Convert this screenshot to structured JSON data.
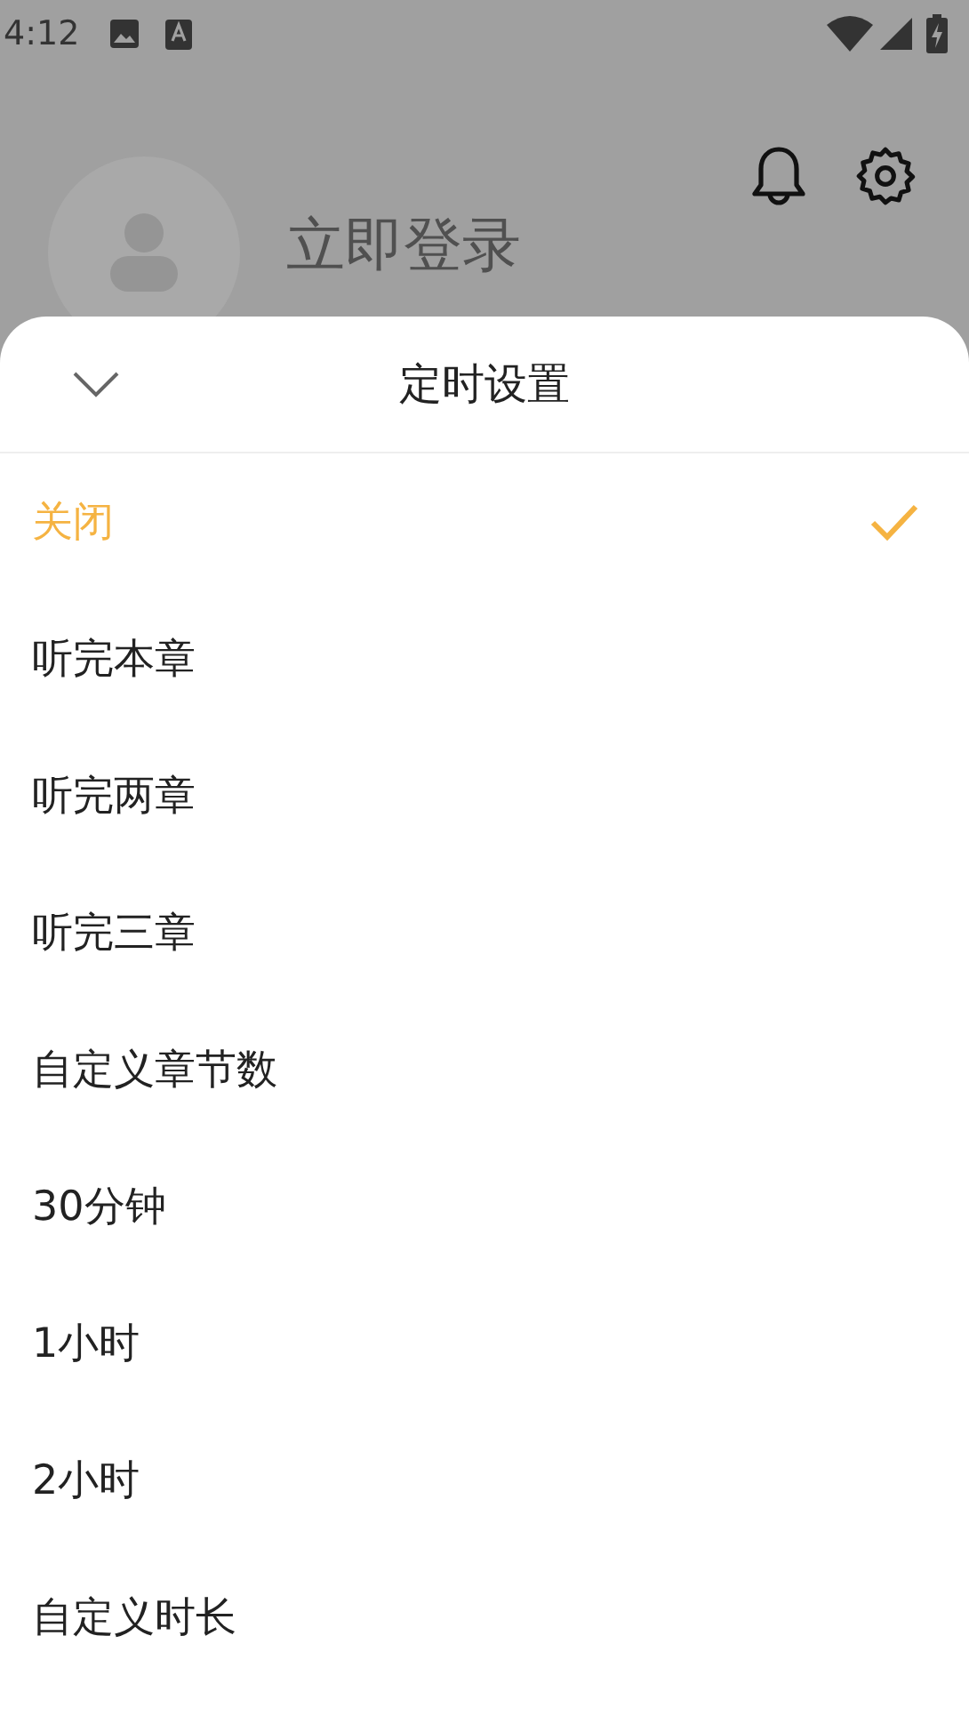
{
  "status_bar": {
    "time": "4:12"
  },
  "profile": {
    "login_text": "立即登录"
  },
  "sheet": {
    "title": "定时设置",
    "options": [
      {
        "label": "关闭",
        "selected": true
      },
      {
        "label": "听完本章",
        "selected": false
      },
      {
        "label": "听完两章",
        "selected": false
      },
      {
        "label": "听完三章",
        "selected": false
      },
      {
        "label": "自定义章节数",
        "selected": false
      },
      {
        "label": "30分钟",
        "selected": false
      },
      {
        "label": "1小时",
        "selected": false
      },
      {
        "label": "2小时",
        "selected": false
      },
      {
        "label": "自定义时长",
        "selected": false
      }
    ]
  }
}
